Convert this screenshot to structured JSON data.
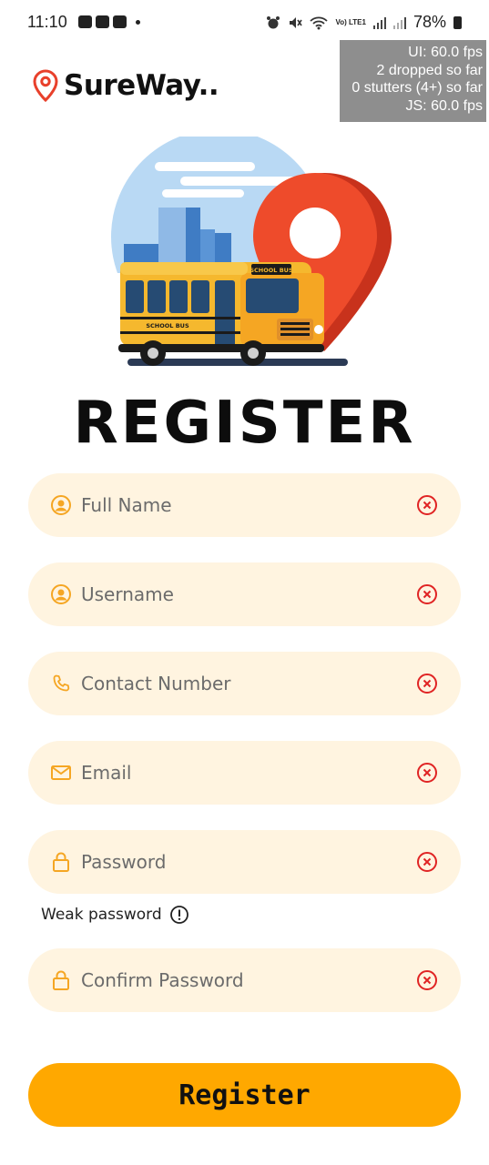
{
  "status_bar": {
    "time": "11:10",
    "battery": "78%",
    "network": "Vo) LTE1"
  },
  "fps_overlay": {
    "line1": "UI: 60.0 fps",
    "line2": "2 dropped so far",
    "line3": "0 stutters (4+) so far",
    "line4": "JS: 60.0 fps"
  },
  "brand": {
    "name": "SureWay..",
    "icon": "map-pin-icon"
  },
  "hero": {
    "bus_label": "SCHOOL BUS",
    "bus_sign": "SCHOOL BUS"
  },
  "page_title": "REGISTER",
  "form": {
    "full_name": {
      "placeholder": "Full Name",
      "icon": "user-circle-icon"
    },
    "username": {
      "placeholder": "Username",
      "icon": "user-circle-icon"
    },
    "contact": {
      "placeholder": "Contact Number",
      "icon": "phone-icon"
    },
    "email": {
      "placeholder": "Email",
      "icon": "mail-icon"
    },
    "password": {
      "placeholder": "Password",
      "icon": "lock-icon"
    },
    "password_hint": "Weak password",
    "confirm_password": {
      "placeholder": "Confirm Password",
      "icon": "lock-icon"
    },
    "submit_label": "Register"
  },
  "colors": {
    "accent": "#ffa800",
    "field_bg": "#fff4e0",
    "icon_orange": "#f5a623",
    "clear_red": "#e02424",
    "pin_red": "#e8402b"
  }
}
